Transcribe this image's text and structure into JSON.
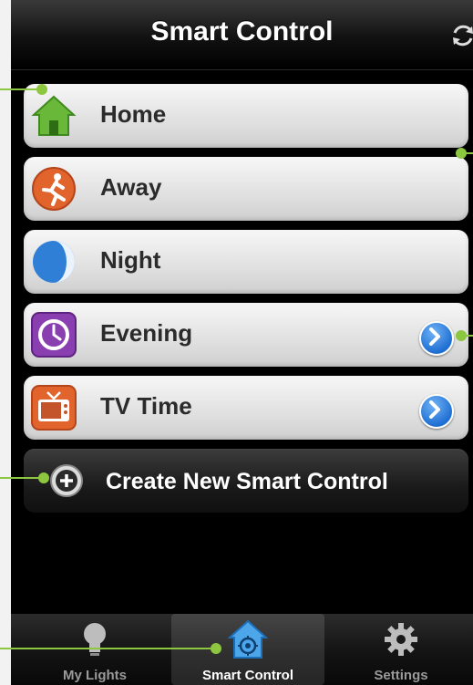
{
  "header": {
    "title": "Smart Control"
  },
  "rows": [
    {
      "label": "Home",
      "icon": "house-icon",
      "chevron": false
    },
    {
      "label": "Away",
      "icon": "running-man-icon",
      "chevron": false
    },
    {
      "label": "Night",
      "icon": "moon-icon",
      "chevron": false
    },
    {
      "label": "Evening",
      "icon": "clock-icon",
      "chevron": true
    },
    {
      "label": "TV Time",
      "icon": "tv-icon",
      "chevron": true
    }
  ],
  "create": {
    "label": "Create New Smart Control"
  },
  "tabs": [
    {
      "label": "My Lights",
      "icon": "lightbulb-icon",
      "active": false
    },
    {
      "label": "Smart Control",
      "icon": "smart-home-icon",
      "active": true
    },
    {
      "label": "Settings",
      "icon": "gear-icon",
      "active": false
    }
  ],
  "colors": {
    "callout": "#8dc63f",
    "accent": "#1f6fd3"
  }
}
